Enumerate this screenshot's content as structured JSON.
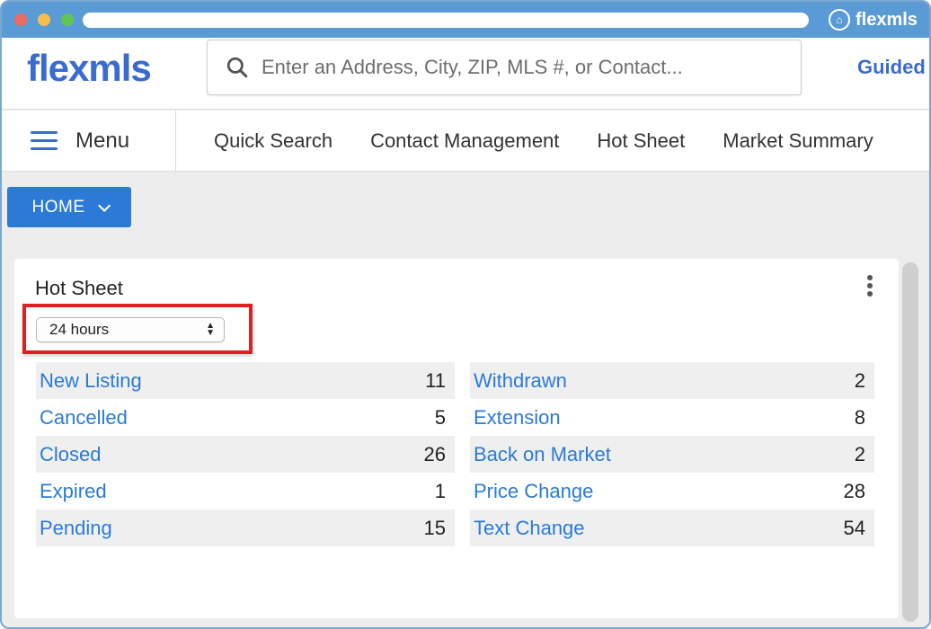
{
  "browser": {
    "brand": "flexmls"
  },
  "header": {
    "logo": "flexmls",
    "search_placeholder": "Enter an Address, City, ZIP, MLS #, or Contact...",
    "guided_label": "Guided"
  },
  "nav": {
    "menu_label": "Menu",
    "items": [
      "Quick Search",
      "Contact Management",
      "Hot Sheet",
      "Market Summary"
    ]
  },
  "home_button": {
    "label": "HOME"
  },
  "hot_sheet": {
    "title": "Hot Sheet",
    "period_selected": "24 hours",
    "left": [
      {
        "label": "New Listing",
        "count": "11"
      },
      {
        "label": "Cancelled",
        "count": "5"
      },
      {
        "label": "Closed",
        "count": "26"
      },
      {
        "label": "Expired",
        "count": "1"
      },
      {
        "label": "Pending",
        "count": "15"
      }
    ],
    "right": [
      {
        "label": "Withdrawn",
        "count": "2"
      },
      {
        "label": "Extension",
        "count": "8"
      },
      {
        "label": "Back on Market",
        "count": "2"
      },
      {
        "label": "Price Change",
        "count": "28"
      },
      {
        "label": "Text Change",
        "count": "54"
      }
    ]
  },
  "colors": {
    "accent": "#2b7bd6",
    "titlebar": "#5b9bd5",
    "highlight": "#e02020"
  }
}
